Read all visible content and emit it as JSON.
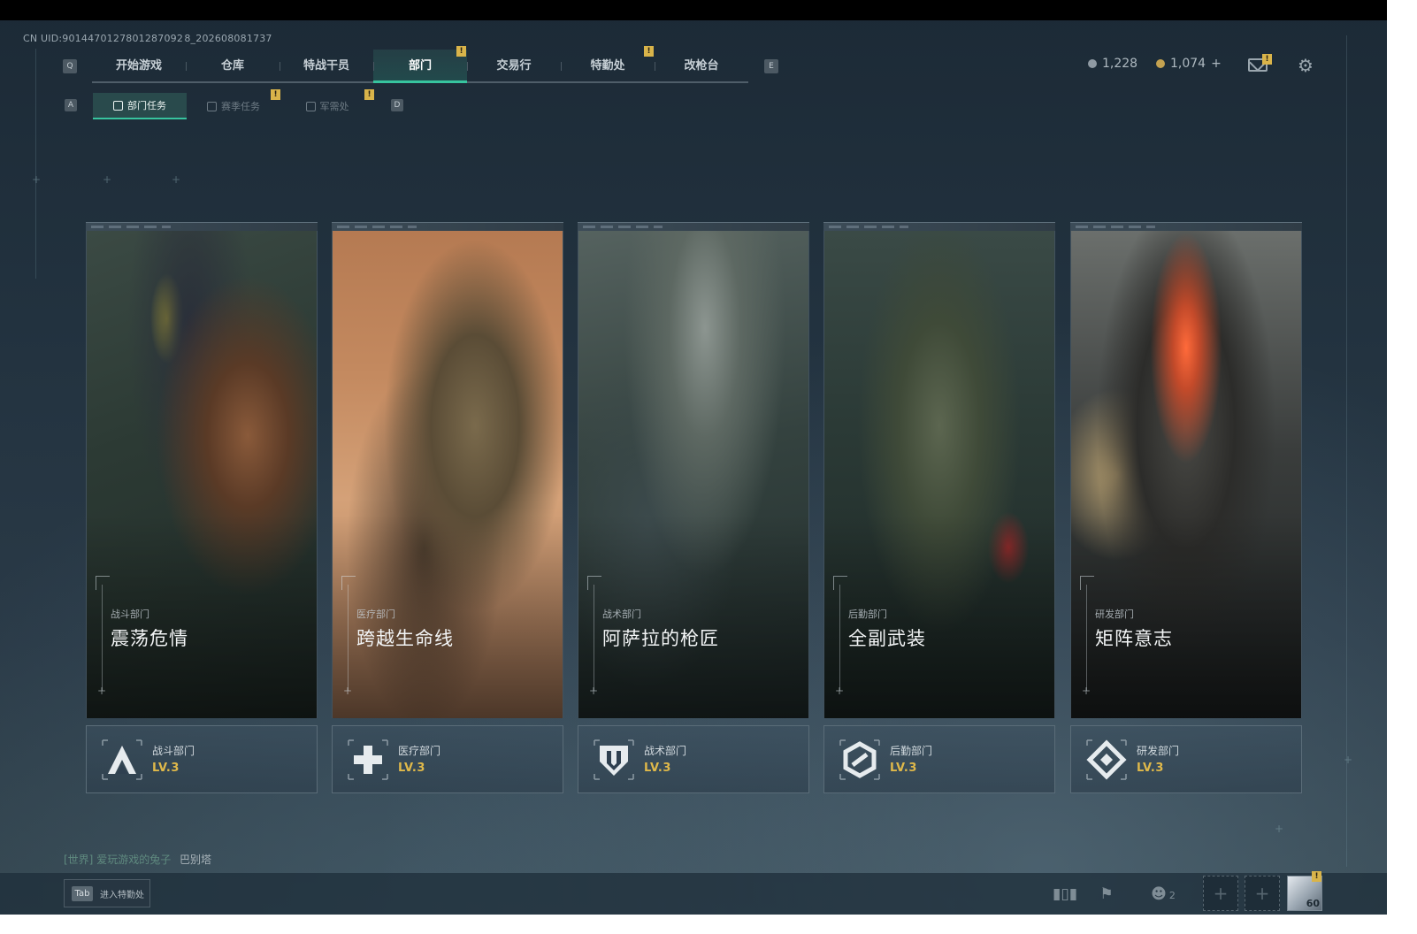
{
  "header": {
    "uid": "CN UID:9014470127801287092 8_202608081737"
  },
  "main_tabs": {
    "left_key": "Q",
    "right_key": "E",
    "items": [
      {
        "label": "开始游戏"
      },
      {
        "label": "仓库"
      },
      {
        "label": "特战干员"
      },
      {
        "label": "部门"
      },
      {
        "label": "交易行"
      },
      {
        "label": "特勤处"
      },
      {
        "label": "改枪台"
      }
    ]
  },
  "sub_tabs": {
    "left_key": "A",
    "right_key": "D",
    "items": [
      {
        "label": "部门任务"
      },
      {
        "label": "赛季任务"
      },
      {
        "label": "军需处"
      }
    ]
  },
  "alert_mark": "!",
  "currency": {
    "silver": "1,228",
    "gold": "1,074",
    "add": "+"
  },
  "departments": [
    {
      "category": "战斗部门",
      "title": "震荡危情",
      "name": "战斗部门",
      "level": "LV.3",
      "icon": "combat-emblem-icon"
    },
    {
      "category": "医疗部门",
      "title": "跨越生命线",
      "name": "医疗部门",
      "level": "LV.3",
      "icon": "medical-cross-icon"
    },
    {
      "category": "战术部门",
      "title": "阿萨拉的枪匠",
      "name": "战术部门",
      "level": "LV.3",
      "icon": "tactical-shield-icon"
    },
    {
      "category": "后勤部门",
      "title": "全副武装",
      "name": "后勤部门",
      "level": "LV.3",
      "icon": "logistics-hex-icon"
    },
    {
      "category": "研发部门",
      "title": "矩阵意志",
      "name": "研发部门",
      "level": "LV.3",
      "icon": "research-diamond-icon"
    }
  ],
  "chat": {
    "channel": "[世界]",
    "sender": "爱玩游戏的兔子",
    "message": "巴别塔"
  },
  "bottom_bar": {
    "tab_key": "Tab",
    "tab_label": "进入特勤处",
    "team_count": "2",
    "avatar_level": "60"
  },
  "colors": {
    "accent": "#37c49e",
    "level": "#e0b94a",
    "alert": "#d9b44a"
  }
}
